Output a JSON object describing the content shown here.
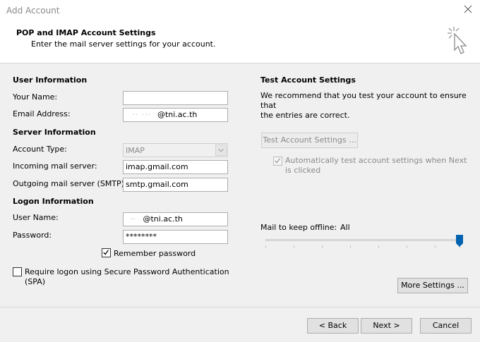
{
  "window": {
    "title": "Add Account"
  },
  "header": {
    "title": "POP and IMAP Account Settings",
    "subtitle": "Enter the mail server settings for your account."
  },
  "user_info": {
    "heading": "User Information",
    "name_label": "Your Name:",
    "name_value": "",
    "email_label": "Email Address:",
    "email_value": "@tni.ac.th"
  },
  "server_info": {
    "heading": "Server Information",
    "account_type_label": "Account Type:",
    "account_type_value": "IMAP",
    "incoming_label": "Incoming mail server:",
    "incoming_value": "imap.gmail.com",
    "outgoing_label": "Outgoing mail server (SMTP):",
    "outgoing_value": "smtp.gmail.com"
  },
  "logon_info": {
    "heading": "Logon Information",
    "username_label": "User Name:",
    "username_value": "@tni.ac.th",
    "password_label": "Password:",
    "password_value": "********",
    "remember_label": "Remember password",
    "remember_checked": true,
    "spa_label_line1": "Require logon using Secure Password Authentication",
    "spa_label_line2": "(SPA)",
    "spa_checked": false
  },
  "test_settings": {
    "heading": "Test Account Settings",
    "desc_line1": "We recommend that you test your account to ensure that",
    "desc_line2": "the entries are correct.",
    "button_label": "Test Account Settings ...",
    "auto_test_line1": "Automatically test account settings when Next",
    "auto_test_line2": "is clicked",
    "auto_test_checked": true
  },
  "offline": {
    "label": "Mail to keep offline:",
    "value": "All",
    "slider_level": 1.0
  },
  "buttons": {
    "more_settings": "More Settings ...",
    "back": "< Back",
    "next": "Next >",
    "cancel": "Cancel"
  },
  "colors": {
    "accent": "#0063b1",
    "border": "#adadad"
  }
}
